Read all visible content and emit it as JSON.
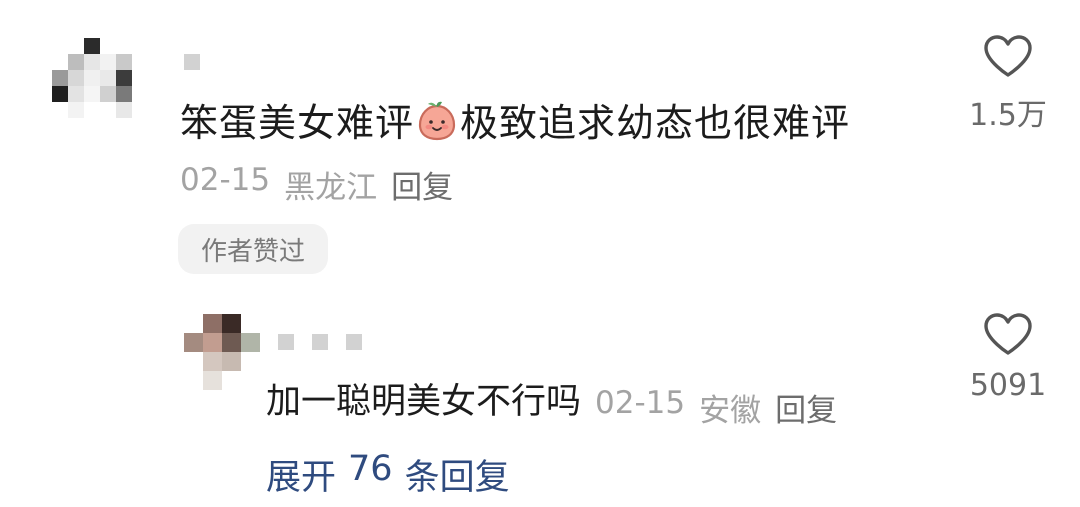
{
  "comment": {
    "text_before_emoji": "笨蛋美女难评",
    "emoji": "peach-face-emoji",
    "text_after_emoji": "极致追求幼态也很难评",
    "date": "02-15",
    "location": "黑龙江",
    "reply_label": "回复",
    "author_badge": "作者赞过",
    "like_count": "1.5万"
  },
  "reply": {
    "text": "加一聪明美女不行吗",
    "date": "02-15",
    "location": "安徽",
    "reply_label": "回复",
    "like_count": "5091"
  },
  "expand": {
    "prefix": "展开",
    "count": "76",
    "suffix": "条回复"
  },
  "colors": {
    "expand_link": "#2f4b7f",
    "meta_text": "#a3a3a3",
    "badge_bg": "#f2f2f2"
  }
}
